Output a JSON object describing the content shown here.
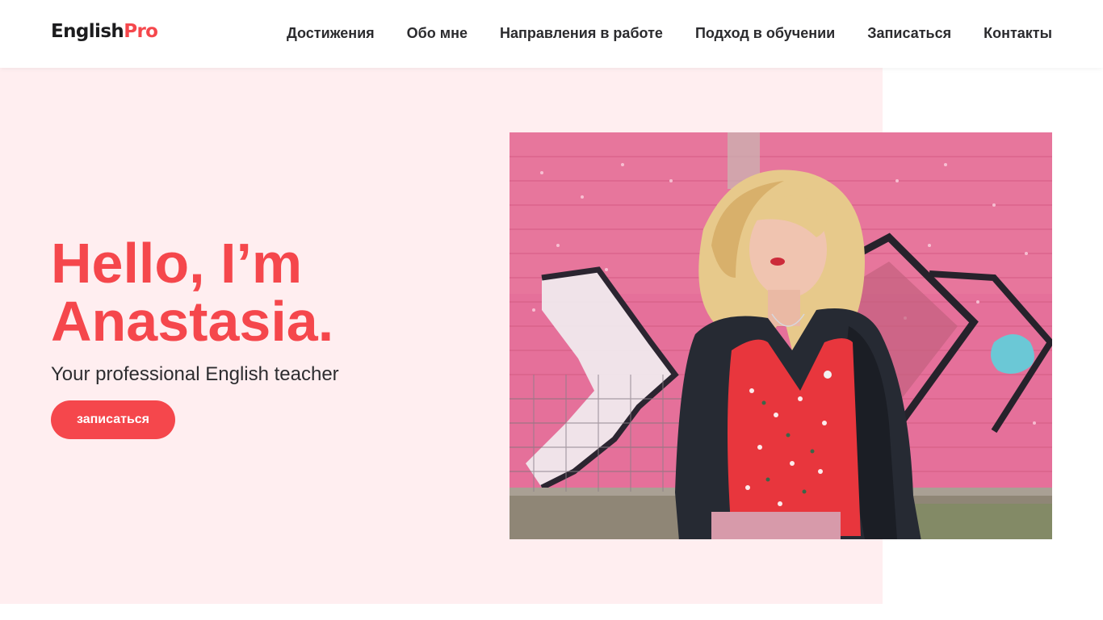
{
  "header": {
    "logo": {
      "part1": "English",
      "part2": "Pro"
    },
    "nav": [
      {
        "label": "Достижения"
      },
      {
        "label": "Обо мне"
      },
      {
        "label": "Направления в работе"
      },
      {
        "label": "Подход в обучении"
      },
      {
        "label": "Записаться"
      },
      {
        "label": "Контакты"
      }
    ]
  },
  "hero": {
    "title_line1": "Hello, I’m",
    "title_line2": "Anastasia.",
    "subtitle": "Your professional English teacher",
    "cta_label": "записаться"
  },
  "colors": {
    "accent": "#f5474c",
    "hero_background": "#ffeef0",
    "nav_text": "#2b2b2e",
    "logo_dark": "#1c1c1e"
  }
}
